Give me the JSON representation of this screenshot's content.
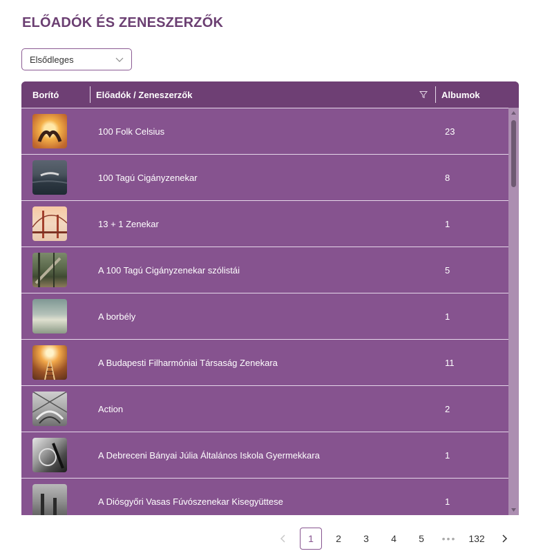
{
  "title": "ELŐADÓK ÉS ZENESZERZŐK",
  "filter_select": {
    "value": "Elsődleges"
  },
  "grid": {
    "columns": {
      "cover": "Borító",
      "artist": "Előadók / Zeneszerzők",
      "albums": "Albumok"
    },
    "rows": [
      {
        "name": "100 Folk Celsius",
        "albums": "23",
        "thumb": "heart-hands-sunset"
      },
      {
        "name": "100 Tagú Cigányzenekar",
        "albums": "8",
        "thumb": "swimmer-water"
      },
      {
        "name": "13 + 1 Zenekar",
        "albums": "1",
        "thumb": "golden-gate-bridge"
      },
      {
        "name": "A 100 Tagú Cigányzenekar szólistái",
        "albums": "5",
        "thumb": "forest-fallen-tree"
      },
      {
        "name": "A borbély",
        "albums": "1",
        "thumb": "cloudy-sky"
      },
      {
        "name": "A Budapesti Filharmóniai Társaság Zenekara",
        "albums": "11",
        "thumb": "railway-sunset"
      },
      {
        "name": "Action",
        "albums": "2",
        "thumb": "bridge-structure"
      },
      {
        "name": "A Debreceni Bányai Júlia Általános Iskola Gyermekkara",
        "albums": "1",
        "thumb": "bw-machinery"
      },
      {
        "name": "A Diósgyőri Vasas Fúvószenekar Kisegyüttese",
        "albums": "1",
        "thumb": "chimneys-sky"
      }
    ]
  },
  "pagination": {
    "pages": [
      "1",
      "2",
      "3",
      "4",
      "5"
    ],
    "ellipsis": "•••",
    "last": "132",
    "current": "1"
  }
}
